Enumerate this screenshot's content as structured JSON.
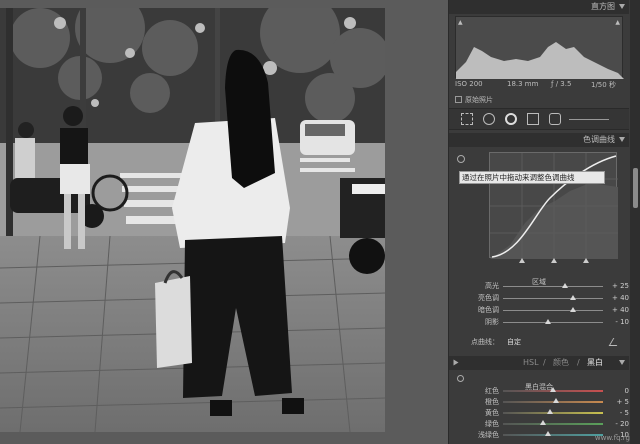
{
  "histogram": {
    "title": "直方图",
    "iso": "ISO 200",
    "focal": "18.3 mm",
    "aperture": "ƒ / 3.5",
    "shutter": "1/50 秒",
    "original_photo_label": "原始照片"
  },
  "tone_curve": {
    "title": "色调曲线",
    "tooltip": "通过在照片中拖动来调整色调曲线",
    "region_label": "区域",
    "point_curve_label": "点曲线：",
    "point_curve_value": "自定",
    "sliders": [
      {
        "label": "高光",
        "value": "+ 25",
        "level": 0.62
      },
      {
        "label": "亮色调",
        "value": "+ 40",
        "level": 0.7
      },
      {
        "label": "暗色调",
        "value": "+ 40",
        "level": 0.7
      },
      {
        "label": "阴影",
        "value": "- 10",
        "level": 0.45
      }
    ]
  },
  "hsl_tabs": {
    "hsl": "HSL",
    "color": "颜色",
    "bw": "黑白",
    "divider": "/"
  },
  "bw_mix": {
    "title": "黑白混合",
    "sliders": [
      {
        "label": "红色",
        "value": "0",
        "level": 0.5,
        "color": "#c85050"
      },
      {
        "label": "橙色",
        "value": "+ 5",
        "level": 0.53,
        "color": "#c88a50"
      },
      {
        "label": "黄色",
        "value": "- 5",
        "level": 0.47,
        "color": "#c8c050"
      },
      {
        "label": "绿色",
        "value": "- 20",
        "level": 0.4,
        "color": "#5aa05a"
      },
      {
        "label": "浅绿色",
        "value": "- 10",
        "level": 0.45,
        "color": "#50a0a0"
      }
    ]
  },
  "watermark": "www.fq.rg"
}
